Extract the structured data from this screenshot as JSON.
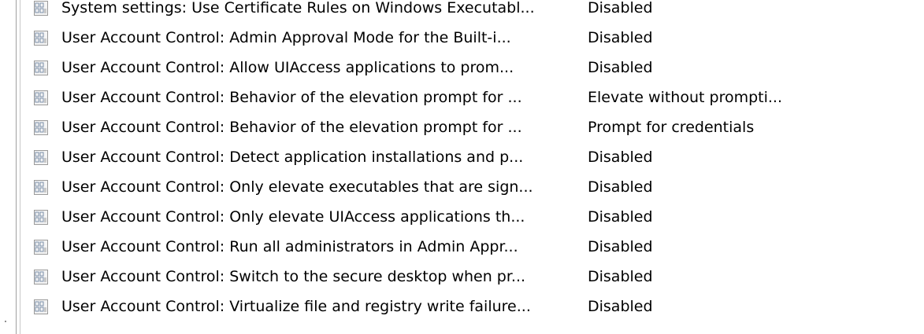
{
  "policies": [
    {
      "name": "System settings: Use Certificate Rules on Windows Executabl...",
      "value": "Disabled"
    },
    {
      "name": "User Account Control: Admin Approval Mode for the Built-i...",
      "value": "Disabled"
    },
    {
      "name": "User Account Control: Allow UIAccess applications to prom...",
      "value": "Disabled"
    },
    {
      "name": "User Account Control: Behavior of the elevation prompt for ...",
      "value": "Elevate without prompti..."
    },
    {
      "name": "User Account Control: Behavior of the elevation prompt for ...",
      "value": "Prompt for credentials"
    },
    {
      "name": "User Account Control: Detect application installations and p...",
      "value": "Disabled"
    },
    {
      "name": "User Account Control: Only elevate executables that are sign...",
      "value": "Disabled"
    },
    {
      "name": "User Account Control: Only elevate UIAccess applications th...",
      "value": "Disabled"
    },
    {
      "name": "User Account Control: Run all administrators in Admin Appr...",
      "value": "Disabled"
    },
    {
      "name": "User Account Control: Switch to the secure desktop when pr...",
      "value": "Disabled"
    },
    {
      "name": "User Account Control: Virtualize file and registry write failure...",
      "value": "Disabled"
    }
  ],
  "icon": "policy-setting-icon"
}
